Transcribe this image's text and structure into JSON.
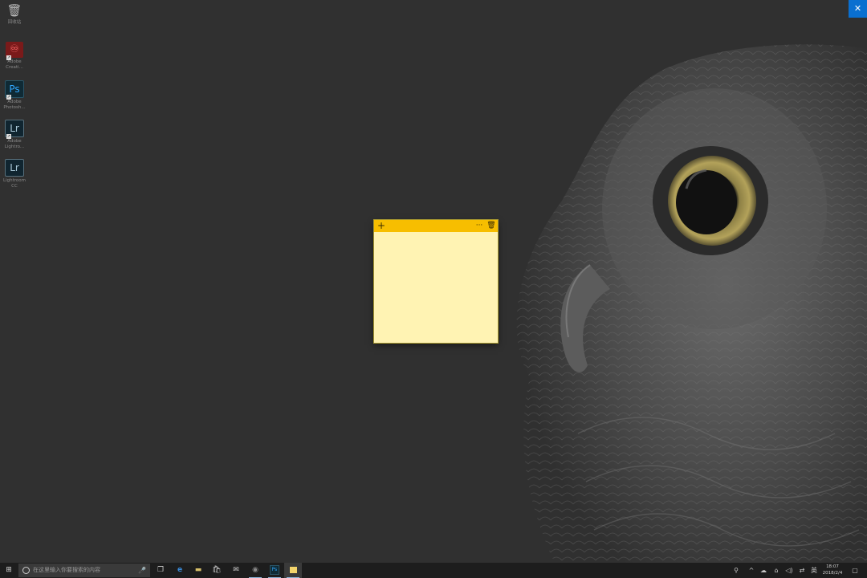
{
  "desktop": {
    "icons": [
      {
        "name": "recycle-bin",
        "glyph": "🗑",
        "label": "回收站"
      },
      {
        "name": "adobe-creative-cloud",
        "glyph": "♾",
        "label": "Adobe\nCreati..."
      },
      {
        "name": "adobe-photoshop",
        "glyph": "Ps",
        "label": "Adobe\nPhotosh..."
      },
      {
        "name": "adobe-lightroom",
        "glyph": "Lr",
        "label": "Adobe\nLightro..."
      },
      {
        "name": "lightroom-cc",
        "glyph": "Lr",
        "label": "Lightroom\nCC"
      }
    ]
  },
  "window": {
    "close_glyph": "✕"
  },
  "sticky_note": {
    "add_glyph": "+",
    "more_glyph": "···",
    "delete_glyph": "🗑",
    "body_text": "",
    "colors": {
      "bar": "#f7be00",
      "body": "#fff3b3"
    }
  },
  "taskbar": {
    "start_glyph": "⊞",
    "search_placeholder": "在这里输入你要搜索的内容",
    "mic_glyph": "🎤",
    "apps": [
      {
        "name": "task-view",
        "glyph": "❐"
      },
      {
        "name": "edge",
        "glyph": "e"
      },
      {
        "name": "file-explorer",
        "glyph": "▬"
      },
      {
        "name": "store",
        "glyph": "🛍"
      },
      {
        "name": "mail",
        "glyph": "✉"
      },
      {
        "name": "app-settings",
        "glyph": "◉"
      },
      {
        "name": "photoshop",
        "glyph": "Ps"
      },
      {
        "name": "sticky-notes",
        "glyph": "▭"
      }
    ],
    "tray": [
      "⚲",
      "^",
      "☁",
      "⌂",
      "◁)",
      "⇄",
      "英"
    ],
    "time": "18:07",
    "date": "2018/2/4",
    "notification_glyph": "▢"
  }
}
